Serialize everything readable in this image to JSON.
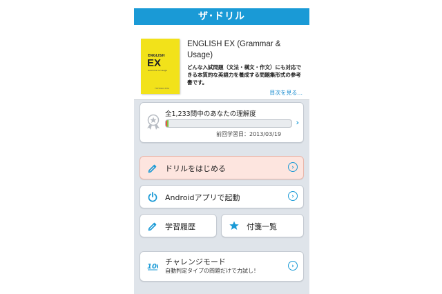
{
  "app": {
    "title": "ザ･ドリル"
  },
  "book": {
    "title": "ENGLISH EX (Grammar & Usage)",
    "description": "どんな入試問題（文法・構文・作文）にも対応できる本質的な英語力を養成する問題集形式の参考書です。",
    "toc_link": "目次を見る...",
    "cover": {
      "line1": "ENGLISH",
      "line2": "EX",
      "line3": "Grammar & Usage",
      "line4": "TOHOGO-SHA",
      "color": "#f2e21a"
    }
  },
  "progress": {
    "title": "全1,233問中のあなたの理解度",
    "fraction": 0.02,
    "last_study": "前回学習日：2013/03/19"
  },
  "buttons": {
    "start": "ドリルをはじめる",
    "android": "Androidアプリで起動",
    "history": "学習履歴",
    "bookmarks": "付箋一覧",
    "challenge": "チャレンジモード",
    "challenge_sub": "自動判定タイプの問題だけで力試し！"
  },
  "colors": {
    "accent": "#1a9ad6",
    "start_bg": "#fde5df",
    "progress_green": "#7dc243"
  },
  "icons": [
    "medal-icon",
    "pencil-icon",
    "power-icon",
    "star-icon",
    "hundred-icon",
    "chevron-right-icon"
  ]
}
